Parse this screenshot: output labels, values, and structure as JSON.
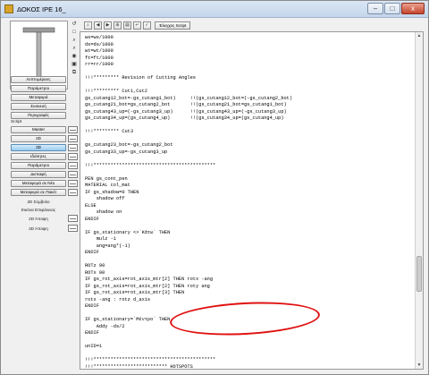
{
  "window": {
    "title": "ΔΟΚΟΣ IPE 16_",
    "minimize": "–",
    "maximize": "□",
    "close": "x"
  },
  "left_panel": {
    "side_tools": [
      "↺",
      "□",
      "⌕",
      "⌕",
      "◉",
      "▣",
      "⧉"
    ],
    "section1": [
      "Λεπτομέρειες",
      "Παράμετροι",
      "Μεταφορά",
      "Συσκευή",
      "Περιγραφές"
    ],
    "section_label": "Script",
    "script_buttons": [
      "Master",
      "2D",
      "3D",
      "Ιδιότητες",
      "Παράμετροι",
      "Διεπαφή",
      "Μεταφορά σε Νέο",
      "Μεταφορά σε Πακέτ"
    ],
    "plain_items": [
      "2D Σύμβολο",
      "Εικόνα Επιφάνειας",
      "2D Άποψη",
      "3D Άποψη"
    ]
  },
  "toolbar": {
    "icons": [
      "search-icon",
      "back-icon",
      "forward-icon",
      "zoom-icon",
      "print-icon",
      "wrap-icon",
      "ok-icon"
    ],
    "icon_glyphs": [
      "⌕",
      "◀",
      "▶",
      "⊞",
      "▤",
      "↵",
      "✓"
    ],
    "check_script": "Έλεγχος Script"
  },
  "code_lines": [
    "ws=ws/1000",
    "ds=ds/1000",
    "wt=wt/1000",
    "ft=ft/1000",
    "rr=rr/1000",
    "",
    "!!!********* Revision of Cutting Angles",
    "",
    "!!!********* Cut1,Cut2",
    "gs_cutang12_bot=-gs_cutang1_bot)     !!(gs_cutang12_bot=(-gs_cutang2_bot)",
    "gs_cutang21_bot=gs_cutang2_bot       !!(gs_cutang21_bot=gs_cutang1_bot)",
    "gs_cutang43_up=(-gs_cutang3_up)      !!(gs_cutang43_up=(-gs_cutang3_up)",
    "gs_cutang34_up=(gs_cutang4_up)       !!(gs_cutang34_up=(gs_cutang4_up)",
    "",
    "!!!********* Cut3",
    "",
    "gs_cutang23_bot=-gs_cutang2_bot",
    "gs_cutang33_up=-gs_cutang3_up",
    "",
    "!!!*******************************************",
    "",
    "PEN gs_cont_pen",
    "MATERIAL col_mat",
    "IF gs_shadow=0 THEN",
    "    shadow off",
    "ELSE",
    "    shadow on",
    "ENDIF",
    "",
    "IF gs_stationary <>`Κάτω` THEN",
    "    mulz -1",
    "    ang=ang*(-1)",
    "ENDIF",
    "",
    "ROTz 90",
    "ROTx 90",
    "IF gs_rot_axis=rot_axis_mtr[2] THEN rotx -ang",
    "IF gs_rot_axis=rot_axis_mtr[2] THEN roty ang",
    "IF gs_rot_axis=rot_axis_mtr[3] THEN",
    "rotx -ang : rotz d_axis",
    "ENDIF",
    "",
    "IF gs_stationary=`Μέντρο` THEN",
    "    Addy -ds/2",
    "ENDIF",
    "",
    "unID=1",
    "",
    "!!!*******************************************",
    "!!!************************** HOTSPOTS",
    "!!!*******************************************"
  ]
}
